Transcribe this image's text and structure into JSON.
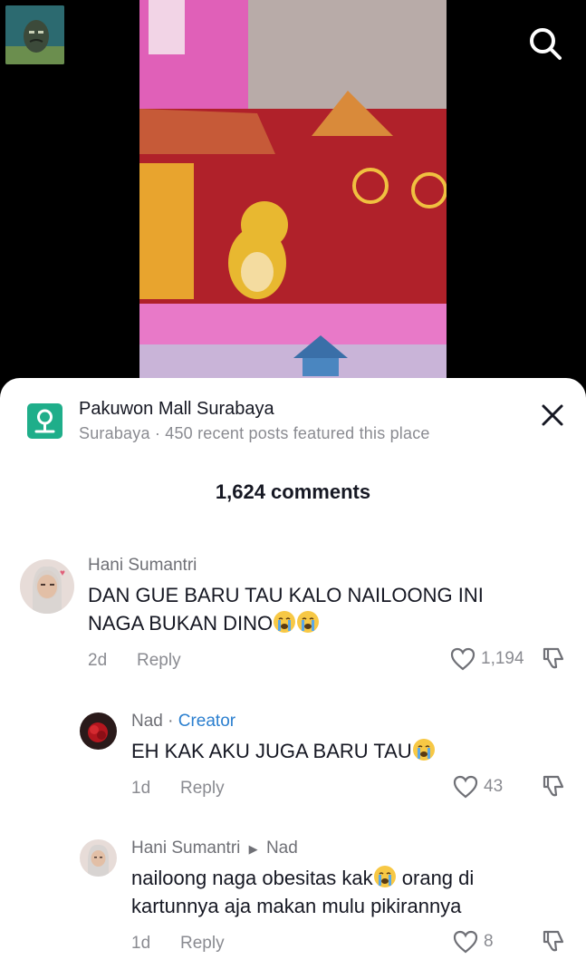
{
  "header": {
    "search_icon": "search-icon",
    "profile_icon": "avatar"
  },
  "location": {
    "title": "Pakuwon Mall Surabaya",
    "subtitle": "Surabaya · 450 recent posts featured this place"
  },
  "comments_count": "1,624 comments",
  "comments": [
    {
      "user": "Hani Sumantri",
      "text_line1": "DAN GUE BARU TAU KALO NAILOONG INI",
      "text_line2": "NAGA BUKAN DINO",
      "time": "2d",
      "reply": "Reply",
      "likes": "1,194"
    },
    {
      "user": "Nad",
      "creator_sep": " · ",
      "creator": "Creator",
      "text_line1": "EH KAK AKU JUGA BARU TAU",
      "time": "1d",
      "reply": "Reply",
      "likes": "43"
    },
    {
      "user": "Hani Sumantri",
      "reply_to": "Nad",
      "text_line1_a": "nailoong naga obesitas kak",
      "text_line1_b": " orang di",
      "text_line2": "kartunnya aja makan mulu pikirannya",
      "time": "1d",
      "reply": "Reply",
      "likes": "8"
    }
  ]
}
